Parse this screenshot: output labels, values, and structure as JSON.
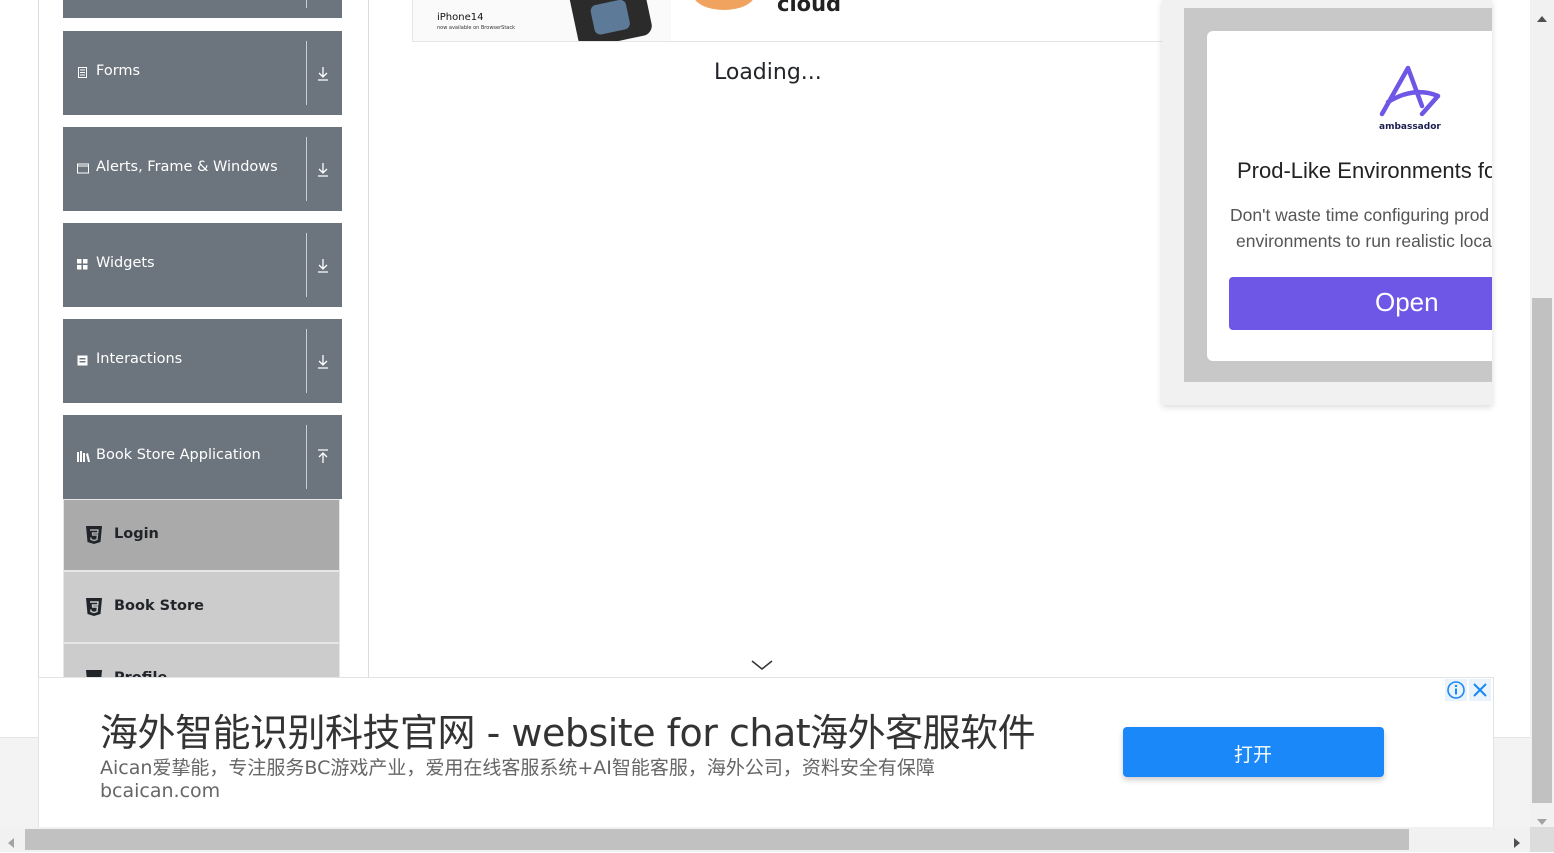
{
  "sidebar": {
    "groups": [
      {
        "label": "Forms",
        "icon": "form-icon"
      },
      {
        "label": "Alerts, Frame & Windows",
        "icon": "window-icon"
      },
      {
        "label": "Widgets",
        "icon": "widgets-icon"
      },
      {
        "label": "Interactions",
        "icon": "interactions-icon"
      },
      {
        "label": "Book Store Application",
        "icon": "books-icon"
      }
    ],
    "book_store_items": [
      {
        "label": "Login"
      },
      {
        "label": "Book Store"
      },
      {
        "label": "Profile"
      }
    ],
    "colors": {
      "group_bg": "#6c757d",
      "active_item_bg": "#aaaaaa",
      "item_bg": "#cccccc"
    }
  },
  "main": {
    "loading_text": "Loading...",
    "top_banner": {
      "phone_text": "iPhone14",
      "phone_subtext": "now available on BrowserStack",
      "word": "cloud"
    }
  },
  "right_ad": {
    "brand": "ambassador",
    "title": "Prod-Like Environments for",
    "text_line1": "Don't waste time configuring prod",
    "text_line2": "environments to run realistic loca",
    "button_label": "Open",
    "accent": "#6e56e6"
  },
  "bottom_ad": {
    "title": "海外智能识别科技官网 - website for chat海外客服软件",
    "description": "Aican爱挚能，专注服务BC游戏产业，爱用在线客服系统+AI智能客服，海外公司，资料安全有保障",
    "domain": "bcaican.com",
    "button_label": "打开",
    "accent": "#1a88f8"
  }
}
